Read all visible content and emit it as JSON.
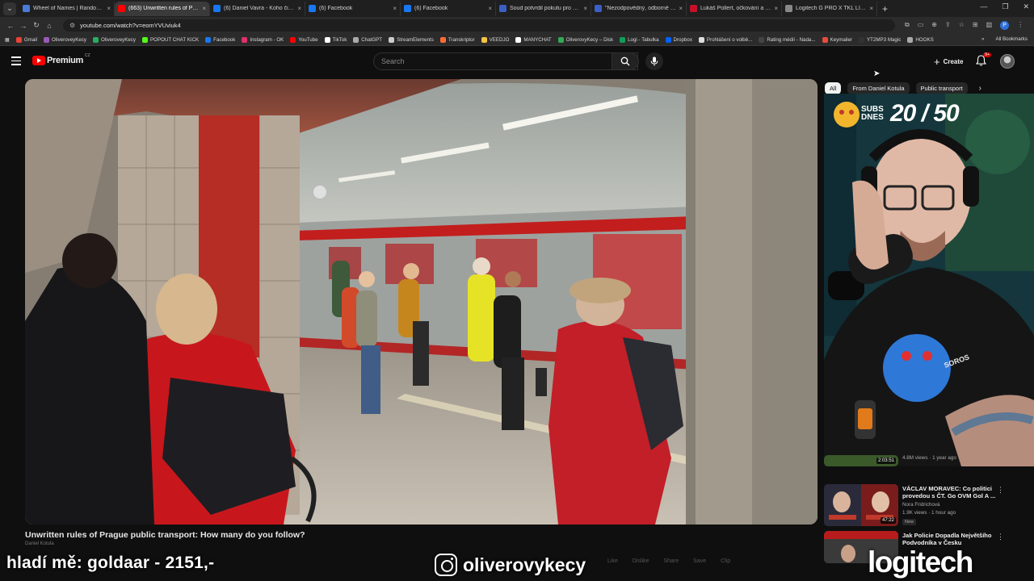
{
  "browser": {
    "tabs": [
      {
        "title": "Wheel of Names | Random nam",
        "color": "#4a7bd8",
        "active": false
      },
      {
        "title": "(663) Unwritten rules of Prague",
        "color": "#ff0000",
        "active": true
      },
      {
        "title": "(6) Daniel Vavra - Koho čist a ší",
        "color": "#1877f2",
        "active": false
      },
      {
        "title": "(6) Facebook",
        "color": "#1877f2",
        "active": false
      },
      {
        "title": "(6) Facebook",
        "color": "#1877f2",
        "active": false
      },
      {
        "title": "Soud potvrdil pokutu pro advo",
        "color": "#3b5fc4",
        "active": false
      },
      {
        "title": "\"Nezodpovědný, odborně neo",
        "color": "#3b5fc4",
        "active": false
      },
      {
        "title": "Lukáš Pollert, očkování a muta",
        "color": "#c4102a",
        "active": false
      },
      {
        "title": "Logitech G PRO X TKL LIGHTSP",
        "color": "#888888",
        "active": false
      }
    ],
    "new_tab": "+",
    "url": "youtube.com/watch?v=eomYVUviuk4",
    "profile_initial": "P",
    "bookmarks": [
      {
        "label": "Gmail",
        "color": "#ea4335"
      },
      {
        "label": "OliveroveyKecy",
        "color": "#9b59b6"
      },
      {
        "label": "OliveroveyKecy",
        "color": "#27ae60"
      },
      {
        "label": "POPOUT CHAT KICK",
        "color": "#53fc18"
      },
      {
        "label": "Facebook",
        "color": "#1877f2"
      },
      {
        "label": "Instagram - OK",
        "color": "#e1306c"
      },
      {
        "label": "YouTube",
        "color": "#ff0000"
      },
      {
        "label": "TikTok",
        "color": "#ffffff"
      },
      {
        "label": "ChatGPT",
        "color": "#aaaaaa"
      },
      {
        "label": "StreamElements",
        "color": "#cccccc"
      },
      {
        "label": "Transkriptor",
        "color": "#ff6b35"
      },
      {
        "label": "VEEDJO",
        "color": "#f4c542"
      },
      {
        "label": "MANYCHAT",
        "color": "#ffffff"
      },
      {
        "label": "OliverovyKecy – Disk",
        "color": "#34a853"
      },
      {
        "label": "Logi - Tabulka",
        "color": "#0f9d58"
      },
      {
        "label": "Dropbox",
        "color": "#0061ff"
      },
      {
        "label": "Prohlášení o volbě...",
        "color": "#dddddd"
      },
      {
        "label": "Rating médií - Nada...",
        "color": "#444444"
      },
      {
        "label": "Keymailer",
        "color": "#e74c3c"
      },
      {
        "label": "YT2MP3 Magic",
        "color": "#333333"
      },
      {
        "label": "HOOKS",
        "color": "#aaaaaa"
      }
    ],
    "bookmarks_overflow": "»",
    "all_bookmarks": "All Bookmarks"
  },
  "header": {
    "logo_text": "Premium",
    "country": "CZ",
    "search_placeholder": "Search",
    "create_label": "Create",
    "notif_count": "9+"
  },
  "video": {
    "title": "Unwritten rules of Prague public transport: How many do you follow?",
    "channel_line": "Daniel Kotula",
    "actions": [
      "Like",
      "Dislike",
      "Share",
      "Save",
      "Clip"
    ]
  },
  "chips": [
    "All",
    "From Daniel Kotula",
    "Public transport"
  ],
  "webcam": {
    "subs_label": "SUBS DNES",
    "subs_count": "20 / 50"
  },
  "related": [
    {
      "title": "",
      "channel": "",
      "meta": "4.8M views · 1 year ago",
      "duration": "2:03:51",
      "new": ""
    },
    {
      "title": "VÁCLAV MORAVEC: Co politici provedou s ČT. Go OVM Gol A ...",
      "channel": "Nora Fridrichová",
      "meta": "1.9K views · 1 hour ago",
      "duration": "47:22",
      "new": "New"
    },
    {
      "title": "Jak Policie Dopadla Největšího Podvodníka v Česku",
      "channel": "",
      "meta": "",
      "duration": "",
      "new": ""
    }
  ],
  "overlay": {
    "left_text": "hladí mě: goldaar - 2151,-",
    "instagram_handle": "oliverovykecy",
    "sponsor": "logitech"
  },
  "colors": {
    "yt_red": "#ff0000",
    "bg": "#0f0f0f",
    "webcam_bg": "#14363c"
  }
}
